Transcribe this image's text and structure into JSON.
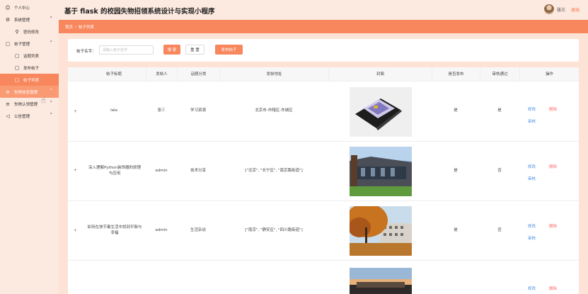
{
  "app": {
    "title": "基于 flask 的校园失物招领系统设计与实现小程序"
  },
  "user": {
    "name": "张三",
    "logout": "退出"
  },
  "sidebar": {
    "items": [
      {
        "label": "个人中心",
        "icon": "person-icon"
      },
      {
        "label": "系统管理",
        "icon": "gear-icon"
      },
      {
        "label": "密码修改",
        "icon": "key-icon"
      },
      {
        "label": "帖子管理",
        "icon": "document-icon"
      },
      {
        "label": "话题列表",
        "icon": "document-icon"
      },
      {
        "label": "发布帖子",
        "icon": "document-icon"
      },
      {
        "label": "帖子列表",
        "icon": "document-icon"
      },
      {
        "label": "失物信息管理",
        "icon": "list-icon"
      },
      {
        "label": "失物认领管理",
        "icon": "list-icon"
      },
      {
        "label": "公告管理",
        "icon": "megaphone-icon"
      }
    ]
  },
  "breadcrumb": {
    "home": "首页",
    "sep": "/",
    "current": "帖子列表"
  },
  "search": {
    "label": "帖子名字：",
    "placeholder": "请输入帖子名字",
    "search_btn": "搜 索",
    "reset_btn": "重 置",
    "add_btn": "发布帖子"
  },
  "table": {
    "headers": [
      "帖子标题",
      "发帖人",
      "话题分类",
      "发帖地址",
      "封面",
      "是否发布",
      "审核通过",
      "操作"
    ],
    "rows": [
      {
        "title": "lala",
        "author": "张三",
        "category": "学习资源",
        "address": "北京市-市辖区-东城区",
        "published": "是",
        "approved": "是",
        "cover": "laptop"
      },
      {
        "title": "深入理解Python装饰器的原理与应用",
        "author": "admin",
        "category": "技术分享",
        "address": "[\"北京\", \"长宁区\", \"南京路街道\"]",
        "published": "是",
        "approved": "否",
        "cover": "building"
      },
      {
        "title": "如何在快节奏生活中找到平衡与幸福",
        "author": "admin",
        "category": "生活杂谈",
        "address": "[\"南京\", \"静安区\", \"四川路街道\"]",
        "published": "是",
        "approved": "否",
        "cover": "autumn"
      },
      {
        "title": "",
        "author": "",
        "category": "",
        "address": "",
        "published": "",
        "approved": "",
        "cover": "sunset"
      }
    ],
    "actions": {
      "edit": "修改",
      "delete": "删除",
      "review": "审核"
    },
    "expand_symbol": "+"
  },
  "colors": {
    "accent": "#f8875d",
    "link": "#4a90e2",
    "danger": "#ff6a6a"
  }
}
